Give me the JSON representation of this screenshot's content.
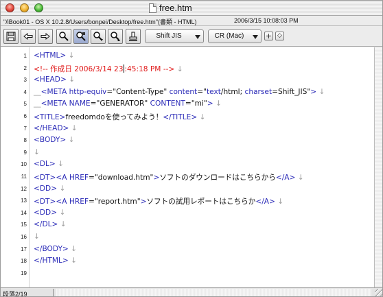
{
  "window": {
    "title": "free.htm",
    "path_info": "\"/iBook01 - OS X 10.2.8/Users/bonpei/Desktop/free.htm\"(書類 - HTML)",
    "datetime": "2006/3/15   10:08:03 PM"
  },
  "toolbar": {
    "buttons": [
      "save-icon",
      "back-icon",
      "forward-icon",
      "search-icon",
      "replace-icon",
      "find-next-icon",
      "find-prev-icon",
      "stamp-icon"
    ],
    "encoding": "Shift JIS",
    "line_ending": "CR (Mac)",
    "plus_label": "+",
    "diamond_label": "◇"
  },
  "editor": {
    "line_end_mark": "↓",
    "indent_mark": "__",
    "lines": [
      {
        "n": "1",
        "tokens": [
          {
            "c": "t-tag",
            "t": "<HTML>"
          }
        ]
      },
      {
        "n": "2",
        "tokens": [
          {
            "c": "t-comment",
            "t": "<!-- 作成日 2006/3/14 23"
          },
          {
            "c": "caret",
            "t": ""
          },
          {
            "c": "t-comment",
            "t": ":45:18 PM -->"
          }
        ]
      },
      {
        "n": "3",
        "tokens": [
          {
            "c": "t-tag",
            "t": "<HEAD>"
          }
        ]
      },
      {
        "n": "4",
        "tokens": [
          {
            "c": "t-mark",
            "t": "__"
          },
          {
            "c": "t-tag",
            "t": "<META "
          },
          {
            "c": "t-attr",
            "t": "http-equiv"
          },
          {
            "c": "t-text",
            "t": "="
          },
          {
            "c": "t-str",
            "t": "\"Content-Type\""
          },
          {
            "c": "t-text",
            "t": " "
          },
          {
            "c": "t-attr",
            "t": "content"
          },
          {
            "c": "t-text",
            "t": "=\""
          },
          {
            "c": "t-attr",
            "t": "text"
          },
          {
            "c": "t-text",
            "t": "/html; "
          },
          {
            "c": "t-attr",
            "t": "charset"
          },
          {
            "c": "t-text",
            "t": "=Shift_JIS\""
          },
          {
            "c": "t-tag",
            "t": ">"
          }
        ]
      },
      {
        "n": "5",
        "tokens": [
          {
            "c": "t-mark",
            "t": "__"
          },
          {
            "c": "t-tag",
            "t": "<META "
          },
          {
            "c": "t-attr",
            "t": "NAME"
          },
          {
            "c": "t-text",
            "t": "="
          },
          {
            "c": "t-str",
            "t": "\"GENERATOR\""
          },
          {
            "c": "t-text",
            "t": " "
          },
          {
            "c": "t-attr",
            "t": "CONTENT"
          },
          {
            "c": "t-text",
            "t": "="
          },
          {
            "c": "t-str",
            "t": "\"mi\""
          },
          {
            "c": "t-tag",
            "t": ">"
          }
        ]
      },
      {
        "n": "6",
        "tokens": [
          {
            "c": "t-tag",
            "t": "<TITLE>"
          },
          {
            "c": "t-text",
            "t": "freedomdoを使ってみよう！"
          },
          {
            "c": "t-tag",
            "t": "</TITLE>"
          }
        ]
      },
      {
        "n": "7",
        "tokens": [
          {
            "c": "t-tag",
            "t": "</HEAD>"
          }
        ]
      },
      {
        "n": "8",
        "tokens": [
          {
            "c": "t-tag",
            "t": "<BODY>"
          }
        ]
      },
      {
        "n": "9",
        "tokens": []
      },
      {
        "n": "10",
        "tokens": [
          {
            "c": "t-tag",
            "t": "<DL>"
          }
        ]
      },
      {
        "n": "11",
        "tokens": [
          {
            "c": "t-tag",
            "t": "<DT>"
          },
          {
            "c": "t-tag",
            "t": "<A "
          },
          {
            "c": "t-attr",
            "t": "HREF"
          },
          {
            "c": "t-text",
            "t": "="
          },
          {
            "c": "t-str",
            "t": "\"download.htm\""
          },
          {
            "c": "t-tag",
            "t": ">"
          },
          {
            "c": "t-text",
            "t": "ソフトのダウンロードはこちらから"
          },
          {
            "c": "t-tag",
            "t": "</A>"
          }
        ]
      },
      {
        "n": "12",
        "tokens": [
          {
            "c": "t-tag",
            "t": "<DD>"
          }
        ]
      },
      {
        "n": "13",
        "tokens": [
          {
            "c": "t-tag",
            "t": "<DT>"
          },
          {
            "c": "t-tag",
            "t": "<A "
          },
          {
            "c": "t-attr",
            "t": "HREF"
          },
          {
            "c": "t-text",
            "t": "="
          },
          {
            "c": "t-str",
            "t": "\"report.htm\""
          },
          {
            "c": "t-tag",
            "t": ">"
          },
          {
            "c": "t-text",
            "t": "ソフトの試用レポートはこちらか"
          },
          {
            "c": "t-tag",
            "t": "</A>"
          }
        ]
      },
      {
        "n": "14",
        "tokens": [
          {
            "c": "t-tag",
            "t": "<DD>"
          }
        ]
      },
      {
        "n": "15",
        "tokens": [
          {
            "c": "t-tag",
            "t": "</DL>"
          }
        ]
      },
      {
        "n": "16",
        "tokens": []
      },
      {
        "n": "17",
        "tokens": [
          {
            "c": "t-tag",
            "t": "</BODY>"
          }
        ]
      },
      {
        "n": "18",
        "tokens": [
          {
            "c": "t-tag",
            "t": "</HTML>"
          }
        ]
      },
      {
        "n": "19",
        "tokens": [],
        "noeol": true
      }
    ]
  },
  "status": {
    "paragraph": "段落2/19"
  }
}
